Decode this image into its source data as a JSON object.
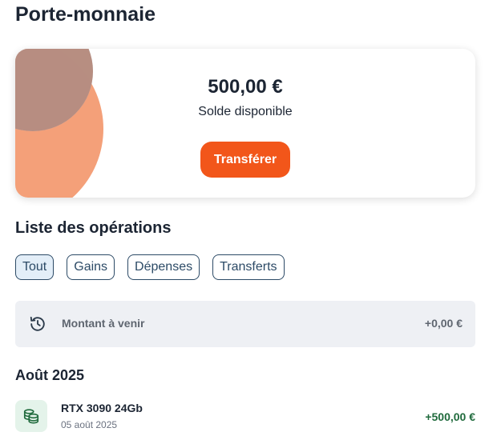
{
  "header": {
    "title": "Porte-monnaie"
  },
  "wallet": {
    "balance": "500,00 €",
    "balance_label": "Solde disponible",
    "transfer_label": "Transférer",
    "accent_color": "#f2561a"
  },
  "operations": {
    "title": "Liste des opérations",
    "filters": [
      {
        "label": "Tout",
        "active": true
      },
      {
        "label": "Gains",
        "active": false
      },
      {
        "label": "Dépenses",
        "active": false
      },
      {
        "label": "Transferts",
        "active": false
      }
    ],
    "pending": {
      "icon": "history-clock-icon",
      "label": "Montant à venir",
      "amount": "+0,00 €"
    },
    "groups": [
      {
        "month": "Août 2025",
        "items": [
          {
            "icon": "coins-stack-icon",
            "name": "RTX 3090 24Gb",
            "date": "05 août 2025",
            "amount": "+500,00 €",
            "amount_color": "#1f6a3c"
          }
        ]
      }
    ]
  }
}
